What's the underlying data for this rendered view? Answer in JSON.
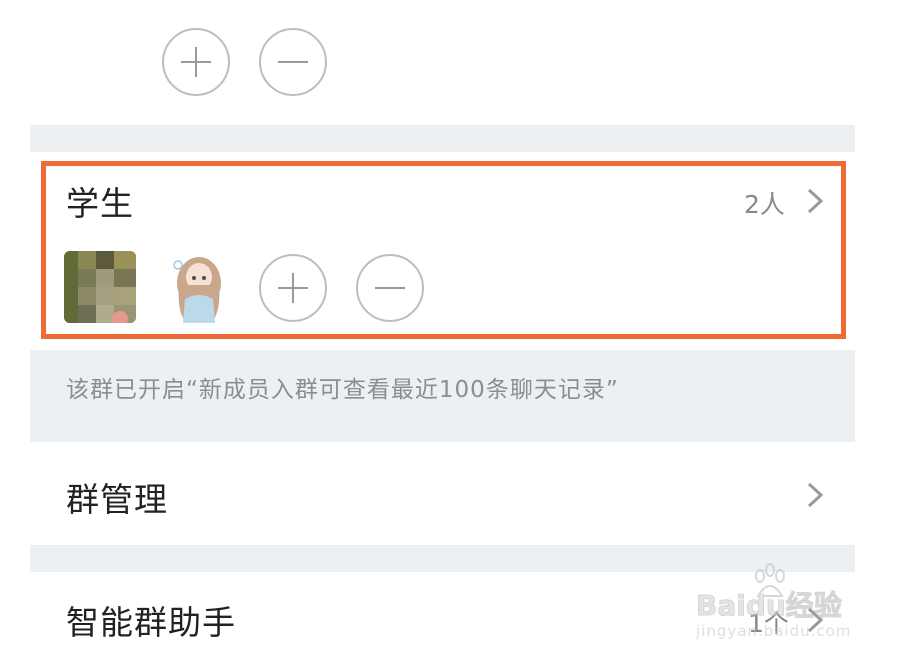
{
  "teachers": {
    "add_label": "+",
    "remove_label": "−"
  },
  "students": {
    "title": "学生",
    "count": "2人",
    "accent_color": "#ef6b34"
  },
  "notice": {
    "text": "该群已开启“新成员入群可查看最近100条聊天记录”"
  },
  "group_management": {
    "label": "群管理"
  },
  "smart_assistant": {
    "label": "智能群助手",
    "value": "1个"
  },
  "watermark": {
    "brand": "Baidu经验",
    "url": "jingyan.baidu.com"
  }
}
